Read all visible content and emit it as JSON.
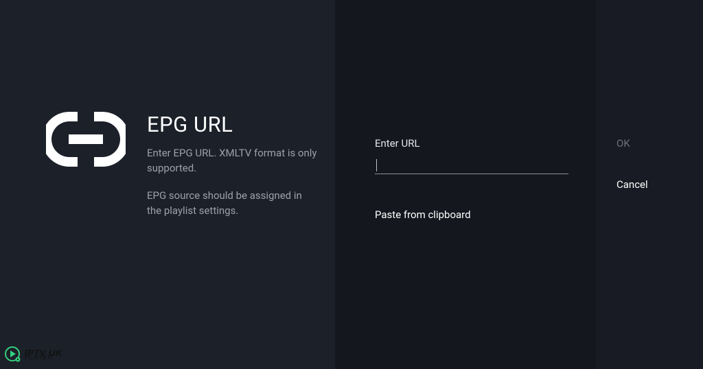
{
  "left": {
    "title": "EPG URL",
    "desc1": "Enter EPG URL. XMLTV format is only supported.",
    "desc2": "EPG source should be assigned in the playlist settings."
  },
  "form": {
    "label": "Enter URL",
    "value": "",
    "paste_label": "Paste from clipboard"
  },
  "actions": {
    "ok": "OK",
    "cancel": "Cancel"
  },
  "watermark": {
    "line1": "IPTV UK",
    "line2": "PLAYER"
  }
}
